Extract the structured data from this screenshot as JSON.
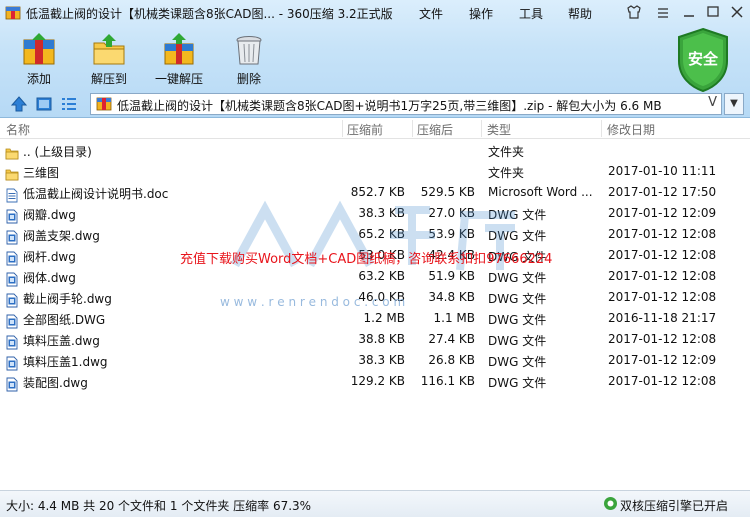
{
  "window": {
    "title": "低温截止阀的设计【机械类课题含8张CAD图... - 360压缩 3.2正式版",
    "menus": [
      "文件",
      "操作",
      "工具",
      "帮助"
    ]
  },
  "toolbar": {
    "add_label": "添加",
    "extract_label": "解压到",
    "oneclick_label": "一键解压",
    "delete_label": "删除",
    "security_label": "安全"
  },
  "address": {
    "path": "低温截止阀的设计【机械类课题含8张CAD图+说明书1万字25页,带三维图】.zip - 解包大小为 6.6 MB",
    "dropdown_glyph": "V",
    "menu_glyph": "▼"
  },
  "columns": {
    "name": "名称",
    "packed": "压缩前",
    "unpacked": "压缩后",
    "type": "类型",
    "modified": "修改日期"
  },
  "files": [
    {
      "name": ".. (上级目录)",
      "packed": "",
      "unpacked": "",
      "type": "文件夹",
      "modified": "",
      "icon": "folder-icon"
    },
    {
      "name": "三维图",
      "packed": "",
      "unpacked": "",
      "type": "文件夹",
      "modified": "2017-01-10 11:11",
      "icon": "folder-icon"
    },
    {
      "name": "低温截止阀设计说明书.doc",
      "packed": "852.7 KB",
      "unpacked": "529.5 KB",
      "type": "Microsoft Word ...",
      "modified": "2017-01-12 17:50",
      "icon": "word-doc-icon"
    },
    {
      "name": "阀瓣.dwg",
      "packed": "38.3 KB",
      "unpacked": "27.0 KB",
      "type": "DWG 文件",
      "modified": "2017-01-12 12:09",
      "icon": "dwg-file-icon"
    },
    {
      "name": "阀盖支架.dwg",
      "packed": "65.2 KB",
      "unpacked": "53.9 KB",
      "type": "DWG 文件",
      "modified": "2017-01-12 12:08",
      "icon": "dwg-file-icon"
    },
    {
      "name": "阀杆.dwg",
      "packed": "53.0 KB",
      "unpacked": "42.4 KB",
      "type": "DWG 文件",
      "modified": "2017-01-12 12:08",
      "icon": "dwg-file-icon"
    },
    {
      "name": "阀体.dwg",
      "packed": "63.2 KB",
      "unpacked": "51.9 KB",
      "type": "DWG 文件",
      "modified": "2017-01-12 12:08",
      "icon": "dwg-file-icon"
    },
    {
      "name": "截止阀手轮.dwg",
      "packed": "46.0 KB",
      "unpacked": "34.8 KB",
      "type": "DWG 文件",
      "modified": "2017-01-12 12:08",
      "icon": "dwg-file-icon"
    },
    {
      "name": "全部图纸.DWG",
      "packed": "1.2 MB",
      "unpacked": "1.1 MB",
      "type": "DWG 文件",
      "modified": "2016-11-18 21:17",
      "icon": "dwg-file-icon"
    },
    {
      "name": "填料压盖.dwg",
      "packed": "38.8 KB",
      "unpacked": "27.4 KB",
      "type": "DWG 文件",
      "modified": "2017-01-12 12:08",
      "icon": "dwg-file-icon"
    },
    {
      "name": "填料压盖1.dwg",
      "packed": "38.3 KB",
      "unpacked": "26.8 KB",
      "type": "DWG 文件",
      "modified": "2017-01-12 12:09",
      "icon": "dwg-file-icon"
    },
    {
      "name": "装配图.dwg",
      "packed": "129.2 KB",
      "unpacked": "116.1 KB",
      "type": "DWG 文件",
      "modified": "2017-01-12 12:08",
      "icon": "dwg-file-icon"
    }
  ],
  "overlay": {
    "notice": "充值下载购买Word文档+CAD图纸稿，咨询联系扣扣97666224",
    "logo_url_text": "w w w . r e n r e n d o c . c o m"
  },
  "status": {
    "summary": "大小: 4.4 MB 共 20 个文件和 1 个文件夹 压缩率 67.3%",
    "engine": "双核压缩引擎已开启"
  }
}
